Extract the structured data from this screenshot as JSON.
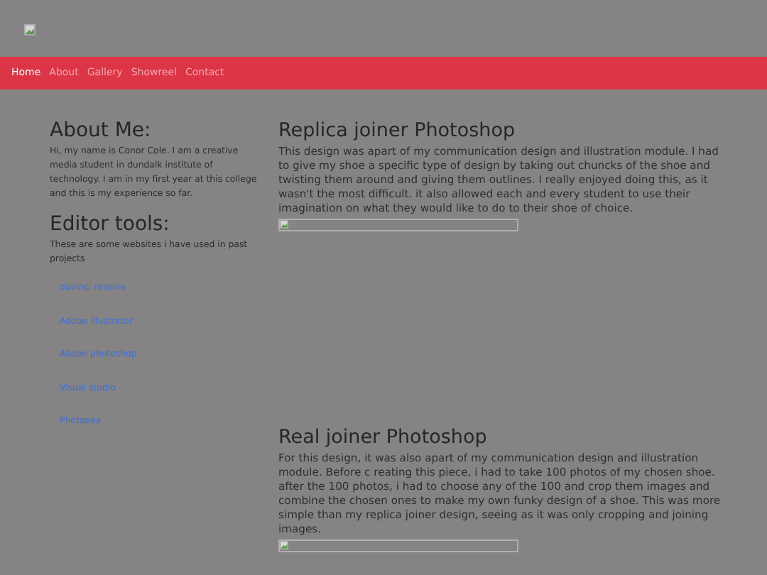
{
  "nav": [
    {
      "label": "Home",
      "selected": true
    },
    {
      "label": "About",
      "selected": false
    },
    {
      "label": "Gallery",
      "selected": false
    },
    {
      "label": "Showreel",
      "selected": false
    },
    {
      "label": "Contact",
      "selected": false
    }
  ],
  "sidebar": {
    "about_title": "About Me:",
    "about_text": "Hi, my name is Conor Cole. I am a creative media student in dundalk institute of technology. I am in my first year at this college and this is my experience so far.",
    "tools_title": "Editor tools:",
    "tools_text": "These are some websites i have used in past projects",
    "links": [
      "davinci resolve",
      "Adobe illustrator",
      "Adobe photoshop",
      "Visual studio",
      "Photopea"
    ]
  },
  "projects": [
    {
      "title": "Replica joiner Photoshop",
      "text": "This design was apart of my communication design and illustration module. I had to give my shoe a specific type of design by taking out chuncks of the shoe and twisting them around and giving them outlines. I really enjoyed doing this, as it wasn't the most difficult. it also allowed each and every student to use their imagination on what they would like to do to their shoe of choice."
    },
    {
      "title": "Real joiner Photoshop",
      "text": "For this design, it was also apart of my communication design and illustration module. Before c reating this piece, i had to take 100 photos of my chosen shoe. after the 100 photos, i had to choose any of the 100 and crop them images and combine the chosen ones to make my own funky design of a shoe. This was more simple than my replica joiner design, seeing as it was only cropping and joining images."
    }
  ]
}
